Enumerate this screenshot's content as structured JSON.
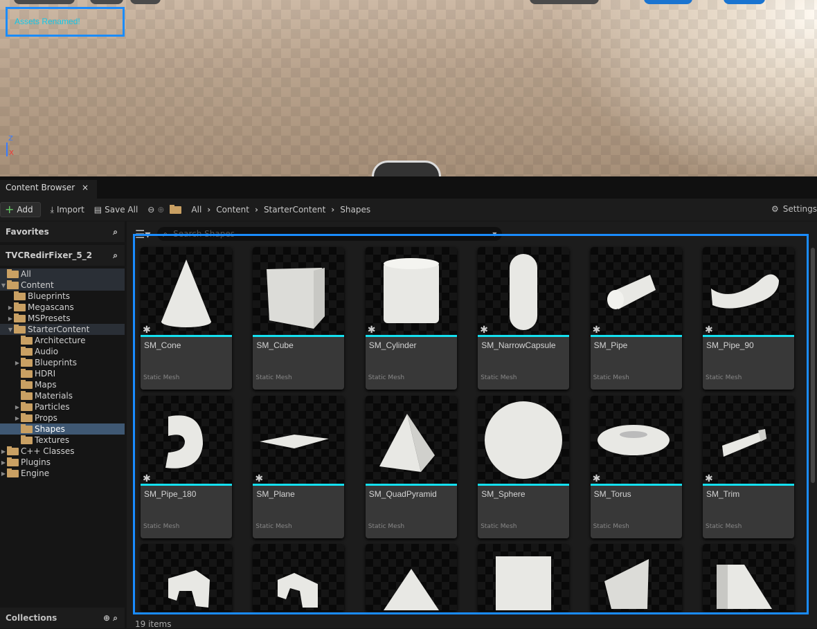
{
  "viewport": {
    "notification": "Assets Renamed!",
    "axes": {
      "z": "Z",
      "x": "X"
    }
  },
  "tab": {
    "title": "Content Browser",
    "close": "×"
  },
  "toolbar": {
    "add": "Add",
    "import": "Import",
    "save_all": "Save All",
    "breadcrumb": [
      "All",
      "Content",
      "StarterContent",
      "Shapes"
    ],
    "settings": "Settings"
  },
  "left": {
    "favorites": "Favorites",
    "project": "TVCRedirFixer_5_2",
    "collections": "Collections",
    "tree": [
      {
        "label": "All",
        "depth": 0,
        "arrow": "",
        "open": true,
        "state": "hl"
      },
      {
        "label": "Content",
        "depth": 0,
        "arrow": "▼",
        "open": true,
        "state": "hl"
      },
      {
        "label": "Blueprints",
        "depth": 1,
        "arrow": ""
      },
      {
        "label": "Megascans",
        "depth": 1,
        "arrow": "▶"
      },
      {
        "label": "MSPresets",
        "depth": 1,
        "arrow": "▶"
      },
      {
        "label": "StarterContent",
        "depth": 1,
        "arrow": "▼",
        "open": true,
        "state": "hl"
      },
      {
        "label": "Architecture",
        "depth": 2,
        "arrow": ""
      },
      {
        "label": "Audio",
        "depth": 2,
        "arrow": ""
      },
      {
        "label": "Blueprints",
        "depth": 2,
        "arrow": "▶"
      },
      {
        "label": "HDRI",
        "depth": 2,
        "arrow": ""
      },
      {
        "label": "Maps",
        "depth": 2,
        "arrow": ""
      },
      {
        "label": "Materials",
        "depth": 2,
        "arrow": ""
      },
      {
        "label": "Particles",
        "depth": 2,
        "arrow": "▶"
      },
      {
        "label": "Props",
        "depth": 2,
        "arrow": "▶"
      },
      {
        "label": "Shapes",
        "depth": 2,
        "arrow": "",
        "state": "sel"
      },
      {
        "label": "Textures",
        "depth": 2,
        "arrow": ""
      },
      {
        "label": "C++ Classes",
        "depth": 0,
        "arrow": "▶",
        "cpp": true
      },
      {
        "label": "Plugins",
        "depth": 0,
        "arrow": "▶"
      },
      {
        "label": "Engine",
        "depth": 0,
        "arrow": "▶"
      }
    ]
  },
  "main": {
    "search_placeholder": "Search Shapes",
    "status": "19 items",
    "assets": [
      {
        "name": "SM_Cone",
        "type": "Static Mesh",
        "shape": "cone",
        "modified": true
      },
      {
        "name": "SM_Cube",
        "type": "Static Mesh",
        "shape": "cube",
        "modified": false
      },
      {
        "name": "SM_Cylinder",
        "type": "Static Mesh",
        "shape": "cylinder",
        "modified": true
      },
      {
        "name": "SM_NarrowCapsule",
        "type": "Static Mesh",
        "shape": "capsule",
        "modified": true
      },
      {
        "name": "SM_Pipe",
        "type": "Static Mesh",
        "shape": "pipe",
        "modified": true
      },
      {
        "name": "SM_Pipe_90",
        "type": "Static Mesh",
        "shape": "pipe90",
        "modified": true
      },
      {
        "name": "SM_Pipe_180",
        "type": "Static Mesh",
        "shape": "pipe180",
        "modified": true
      },
      {
        "name": "SM_Plane",
        "type": "Static Mesh",
        "shape": "plane",
        "modified": true
      },
      {
        "name": "SM_QuadPyramid",
        "type": "Static Mesh",
        "shape": "pyramid",
        "modified": false
      },
      {
        "name": "SM_Sphere",
        "type": "Static Mesh",
        "shape": "sphere",
        "modified": false
      },
      {
        "name": "SM_Torus",
        "type": "Static Mesh",
        "shape": "torus",
        "modified": true
      },
      {
        "name": "SM_Trim",
        "type": "Static Mesh",
        "shape": "trim",
        "modified": true
      },
      {
        "name": "",
        "type": "",
        "shape": "arch1"
      },
      {
        "name": "",
        "type": "",
        "shape": "arch2"
      },
      {
        "name": "",
        "type": "",
        "shape": "tri"
      },
      {
        "name": "",
        "type": "",
        "shape": "cyl2"
      },
      {
        "name": "",
        "type": "",
        "shape": "wedge1"
      },
      {
        "name": "",
        "type": "",
        "shape": "wedge2"
      }
    ]
  },
  "colors": {
    "accent": "#1a8cff",
    "asset_underline": "#14e0f0",
    "folder": "#c9a063",
    "selected": "#3f5873"
  }
}
